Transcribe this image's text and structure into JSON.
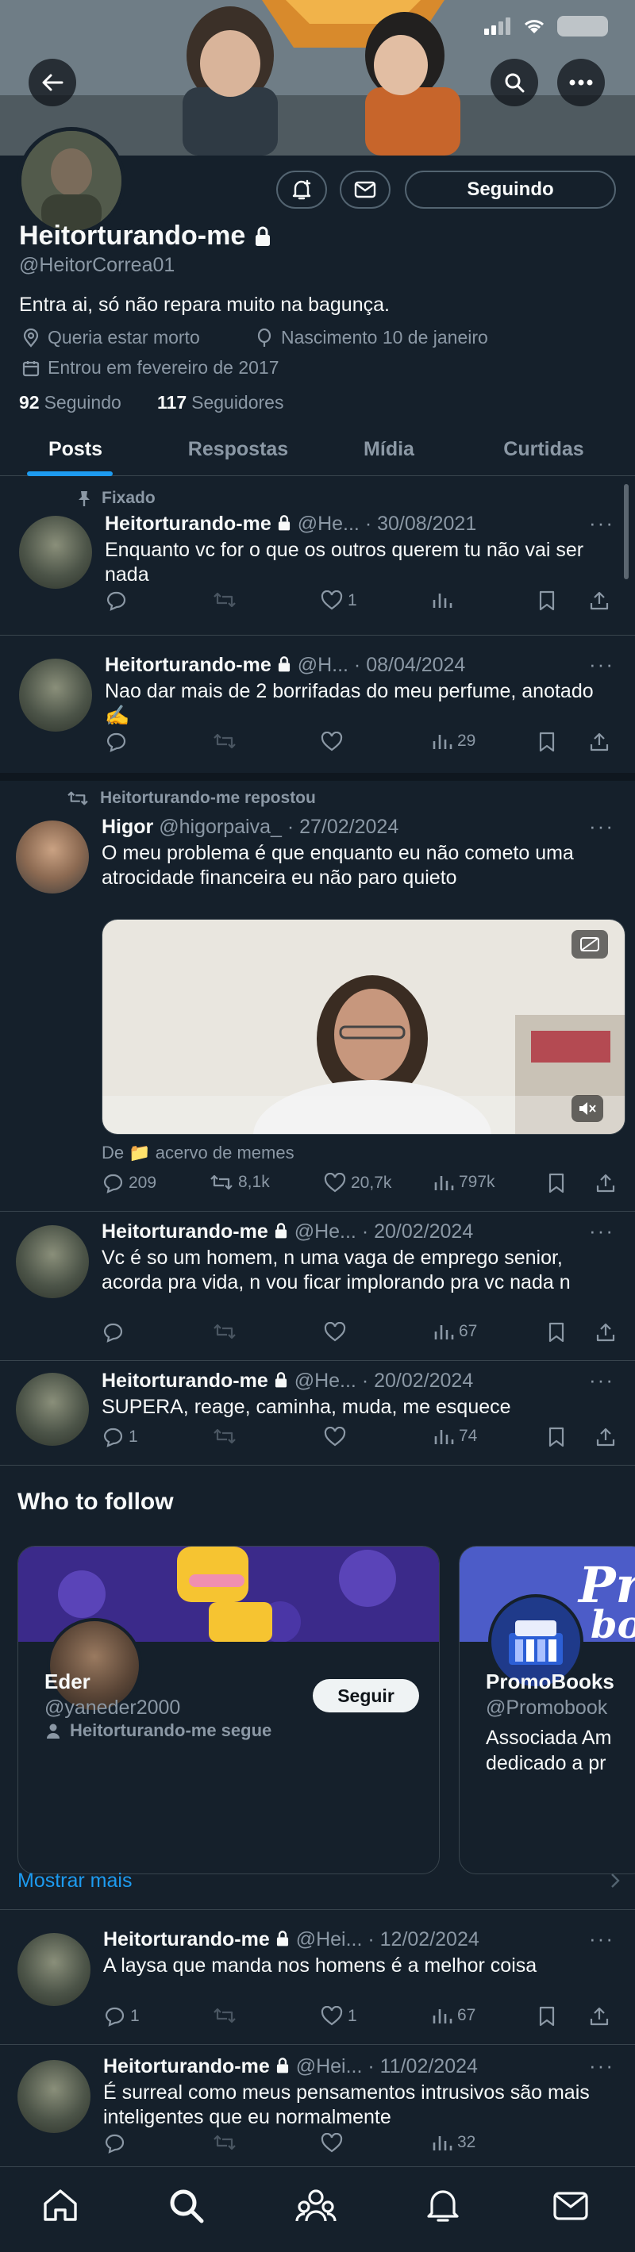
{
  "profile": {
    "display_name": "Heitorturando-me",
    "handle": "@HeitorCorrea01",
    "bio": "Entra ai, só não repara muito na bagunça.",
    "location": "Queria estar morto",
    "birthday": "Nascimento 10 de janeiro",
    "joined": "Entrou em fevereiro de 2017",
    "following_count": "92",
    "following_label": "Seguindo",
    "followers_count": "117",
    "followers_label": "Seguidores",
    "following_button": "Seguindo"
  },
  "tabs": [
    "Posts",
    "Respostas",
    "Mídia",
    "Curtidas"
  ],
  "tweets": [
    {
      "pinned_label": "Fixado",
      "name": "Heitorturando-me",
      "handle": "@He...",
      "date": "· 30/08/2021",
      "text": "Enquanto vc for o que os outros querem tu não vai ser nada",
      "likes": "1"
    },
    {
      "name": "Heitorturando-me",
      "handle": "@H...",
      "date": "· 08/04/2024",
      "text": "Nao dar mais de 2 borrifadas do meu perfume, anotado ✍️",
      "views": "29"
    },
    {
      "repost_label": "Heitorturando-me repostou",
      "name": "Higor",
      "handle": "@higorpaiva_",
      "date": "· 27/02/2024",
      "text": "O meu problema é que enquanto eu não cometo uma atrocidade financeira eu não paro quieto",
      "source": "De 📁 acervo de memes",
      "replies": "209",
      "reposts": "8,1k",
      "likes": "20,7k",
      "views": "797k"
    },
    {
      "name": "Heitorturando-me",
      "handle": "@He...",
      "date": "· 20/02/2024",
      "text": "Vc é so um homem, n uma vaga de emprego senior, acorda pra vida, n vou ficar implorando pra vc nada n",
      "views": "67"
    },
    {
      "name": "Heitorturando-me",
      "handle": "@He...",
      "date": "· 20/02/2024",
      "text": "SUPERA, reage, caminha, muda, me esquece",
      "replies": "1",
      "views": "74"
    },
    {
      "name": "Heitorturando-me",
      "handle": "@Hei...",
      "date": "· 12/02/2024",
      "text": "A laysa que manda nos homens é a melhor coisa",
      "replies": "1",
      "likes": "1",
      "views": "67"
    },
    {
      "name": "Heitorturando-me",
      "handle": "@Hei...",
      "date": "· 11/02/2024",
      "text": "É surreal como meus pensamentos intrusivos são mais inteligentes que eu normalmente",
      "views": "32"
    }
  ],
  "who_to_follow": {
    "title": "Who to follow",
    "cards": [
      {
        "name": "Eder",
        "handle": "@yaneder2000",
        "follow_button": "Seguir",
        "context": "Heitorturando-me segue"
      },
      {
        "name": "PromoBooks",
        "handle": "@Promobook",
        "bio": "Associada Am dedicado a pr"
      }
    ],
    "show_more": "Mostrar mais"
  },
  "colors": {
    "background": "#15202b",
    "accent": "#1d9bf0",
    "muted": "#8b98a5",
    "border": "#38444d"
  }
}
